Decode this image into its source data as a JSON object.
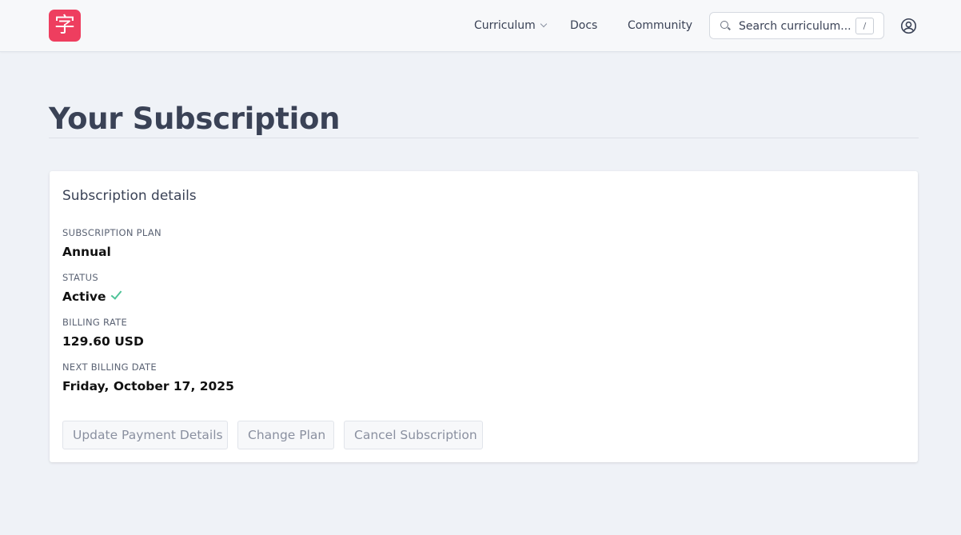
{
  "header": {
    "logo_glyph": "字",
    "nav": [
      {
        "label": "Curriculum",
        "has_dropdown": true
      },
      {
        "label": "Docs"
      },
      {
        "label": "Community"
      }
    ],
    "search": {
      "placeholder": "Search curriculum...",
      "shortcut": "/"
    },
    "user_icon": "user-circle-icon"
  },
  "page": {
    "title": "Your Subscription"
  },
  "card": {
    "title": "Subscription details",
    "fields": [
      {
        "label": "SUBSCRIPTION PLAN",
        "value": "Annual"
      },
      {
        "label": "STATUS",
        "value": "Active",
        "status_icon": "check-icon",
        "status_color": "#4fc398"
      },
      {
        "label": "BILLING RATE",
        "value": "129.60 USD"
      },
      {
        "label": "NEXT BILLING DATE",
        "value": "Friday, October 17, 2025"
      }
    ],
    "buttons": {
      "update_payment": "Update Payment Details",
      "change_plan": "Change Plan",
      "cancel": "Cancel Subscription"
    }
  },
  "colors": {
    "brand": "#ee3e5f",
    "background": "#eff2f7",
    "text": "#3a4256",
    "success": "#4fc398"
  }
}
